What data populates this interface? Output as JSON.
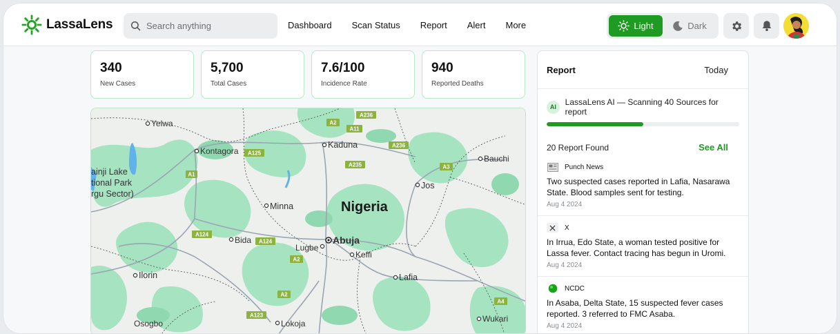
{
  "app": {
    "name": "LassaLens"
  },
  "search": {
    "placeholder": "Search anything"
  },
  "nav": {
    "items": [
      "Dashboard",
      "Scan Status",
      "Report",
      "Alert",
      "More"
    ]
  },
  "theme": {
    "light_label": "Light",
    "dark_label": "Dark",
    "selected": "Light"
  },
  "stats": [
    {
      "value": "340",
      "label": "New Cases"
    },
    {
      "value": "5,700",
      "label": "Total Cases"
    },
    {
      "value": "7.6/100",
      "label": "Incidence Rate"
    },
    {
      "value": "940",
      "label": "Reported Deaths"
    }
  ],
  "map": {
    "country": "Nigeria",
    "places": [
      "Yelwa",
      "Kontagora",
      "Kaduna",
      "Bauchi",
      "Jos",
      "Minna",
      "Bida",
      "Lugbe",
      "Abuja",
      "Keffi",
      "Ilorin",
      "Lafia",
      "Wukari",
      "Osogbo",
      "Lokoja"
    ],
    "park_lines": [
      "ainji Lake",
      "tional Park",
      "rgu Sector)"
    ],
    "roads": [
      "A236",
      "A2",
      "A11",
      "A125",
      "A236",
      "A235",
      "A3",
      "A1",
      "A124",
      "A124",
      "A2",
      "A2",
      "A4",
      "A123"
    ]
  },
  "report": {
    "title": "Report",
    "range": "Today",
    "ai_badge": "AI",
    "ai_status": "LassaLens AI — Scanning 40 Sources for report",
    "scan_progress": 0.5,
    "found": "20 Report Found",
    "see_all": "See All",
    "items": [
      {
        "source": "Punch News",
        "text": "Two suspected cases reported in Lafia, Nasarawa State. Blood samples sent for testing.",
        "date": "Aug 4 2024"
      },
      {
        "source": "X",
        "text": "In Irrua, Edo State, a woman tested positive for Lassa fever. Contact tracing has begun in Uromi.",
        "date": "Aug 4 2024"
      },
      {
        "source": "NCDC",
        "text": "In Asaba, Delta State, 15 suspected fever cases reported. 3 referred to FMC Asaba.",
        "date": "Aug 4 2024"
      }
    ]
  },
  "colors": {
    "accent": "#1f9a22",
    "card_border": "#b9e6c9",
    "map_green": "#9fe0bd"
  }
}
